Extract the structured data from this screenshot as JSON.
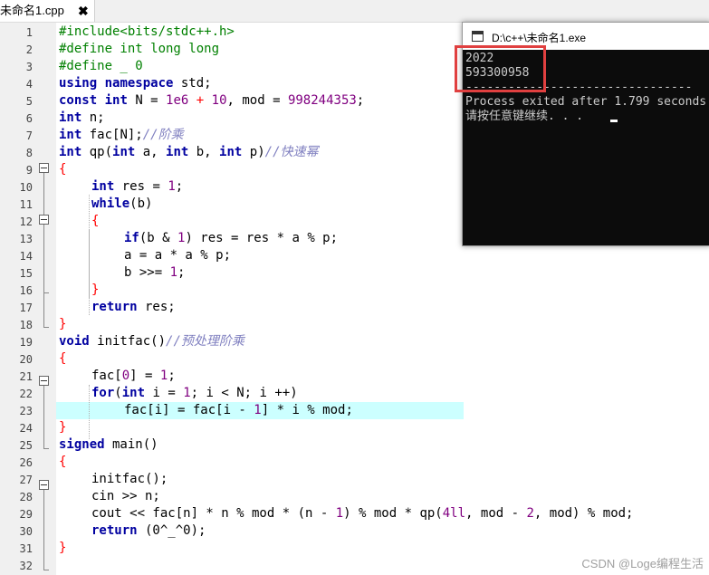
{
  "tab": {
    "title": "未命名1.cpp",
    "close": "✖"
  },
  "line_numbers": [
    "1",
    "2",
    "3",
    "4",
    "5",
    "6",
    "7",
    "8",
    "9",
    "10",
    "11",
    "12",
    "13",
    "14",
    "15",
    "16",
    "17",
    "18",
    "19",
    "20",
    "21",
    "22",
    "23",
    "24",
    "25",
    "26",
    "27",
    "28",
    "29",
    "30",
    "31",
    "32"
  ],
  "code": {
    "l1": "#include<bits/stdc++.h>",
    "l2": "#define int long long",
    "l3": "#define _ 0",
    "l4a": "using",
    "l4b": "namespace",
    "l4c": " std;",
    "l5a": "const",
    "l5b": "int",
    "l5c": " N = ",
    "l5d": "1e6",
    "l5e": " + ",
    "l5f": "10",
    "l5g": ", mod = ",
    "l5h": "998244353",
    "l5i": ";",
    "l6a": "int",
    "l6b": " n;",
    "l7a": "int",
    "l7b": " fac[N];",
    "l7c": "//阶乘",
    "l8a": "int",
    "l8b": " qp(",
    "l8c": "int",
    "l8d": " a, ",
    "l8e": "int",
    "l8f": " b, ",
    "l8g": "int",
    "l8h": " p)",
    "l8i": "//快速幂",
    "l9": "{",
    "l10a": "int",
    "l10b": " res = ",
    "l10c": "1",
    "l10d": ";",
    "l11a": "while",
    "l11b": "(b)",
    "l12": "{",
    "l13a": "if",
    "l13b": "(b & ",
    "l13c": "1",
    "l13d": ") res = res * a % p;",
    "l14": "a = a * a % p;",
    "l15a": "b >>= ",
    "l15b": "1",
    "l15c": ";",
    "l16": "}",
    "l17a": "return",
    "l17b": " res;",
    "l18": "}",
    "l19a": "void",
    "l19b": " initfac()",
    "l19c": "//预处理阶乘",
    "l20": "{",
    "l21a": "fac[",
    "l21b": "0",
    "l21c": "] = ",
    "l21d": "1",
    "l21e": ";",
    "l22a": "for",
    "l22b": "(",
    "l22c": "int",
    "l22d": " i = ",
    "l22e": "1",
    "l22f": "; i < N; i ++)",
    "l23a": "fac[i] = fac[i - ",
    "l23b": "1",
    "l23c": "] * i % mod;",
    "l24": "}",
    "l25a": "signed",
    "l25b": " main()",
    "l26": "{",
    "l27": "initfac();",
    "l28": "cin >> n;",
    "l29a": "cout << fac[n] * n % mod * (n - ",
    "l29b": "1",
    "l29c": ") % mod * qp(",
    "l29d": "4ll",
    "l29e": ", mod - ",
    "l29f": "2",
    "l29g": ", mod) % mod;",
    "l30a": "return",
    "l30b": " (0^_^0);",
    "l31": "}"
  },
  "console": {
    "title": "D:\\c++\\未命名1.exe",
    "lines": [
      "2022",
      "593300958",
      "--------------------------------",
      "Process exited after 1.799 seconds",
      "请按任意键继续. . . "
    ]
  },
  "watermark": "CSDN @Loge编程生活",
  "colors": {
    "keyword": "#0000a0",
    "preprocessor": "#008000",
    "number": "#800080",
    "comment": "#8080c0",
    "highlight": "#ccffff",
    "annotation": "#e04040"
  }
}
